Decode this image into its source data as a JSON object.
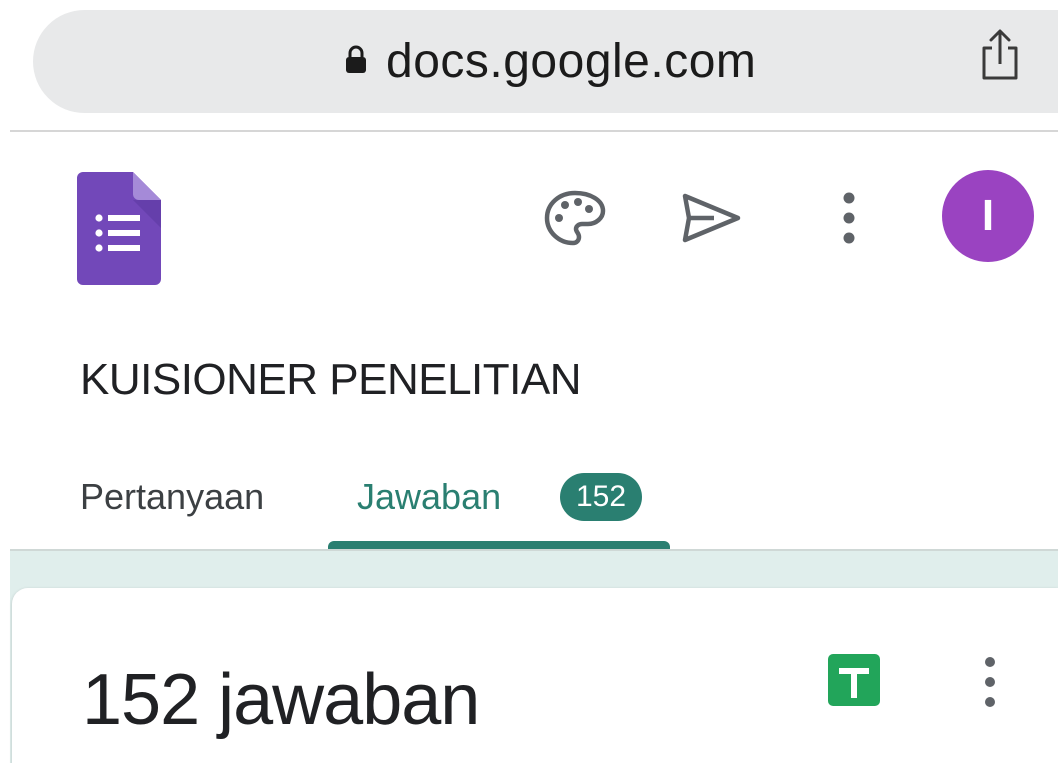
{
  "browser": {
    "url": "docs.google.com",
    "icons": {
      "lock": "lock-icon",
      "share": "share-icon"
    }
  },
  "header": {
    "icons": {
      "logo": "google-forms-logo",
      "palette": "palette-icon",
      "send": "send-icon",
      "more": "more-vert-icon"
    },
    "avatar_initial": "I"
  },
  "form": {
    "title": "KUISIONER PENELITIAN"
  },
  "tabs": [
    {
      "label": "Pertanyaan",
      "active": false
    },
    {
      "label": "Jawaban",
      "active": true,
      "badge": "152"
    }
  ],
  "responses": {
    "title": "152 jawaban",
    "icons": {
      "sheets": "google-sheets-icon",
      "more": "more-vert-icon"
    }
  },
  "colors": {
    "accent": "#2a7f71",
    "forms_purple": "#7248b9",
    "avatar": "#9a43c1",
    "sheets_green": "#22a55a",
    "content_bg": "#e0eeec"
  }
}
